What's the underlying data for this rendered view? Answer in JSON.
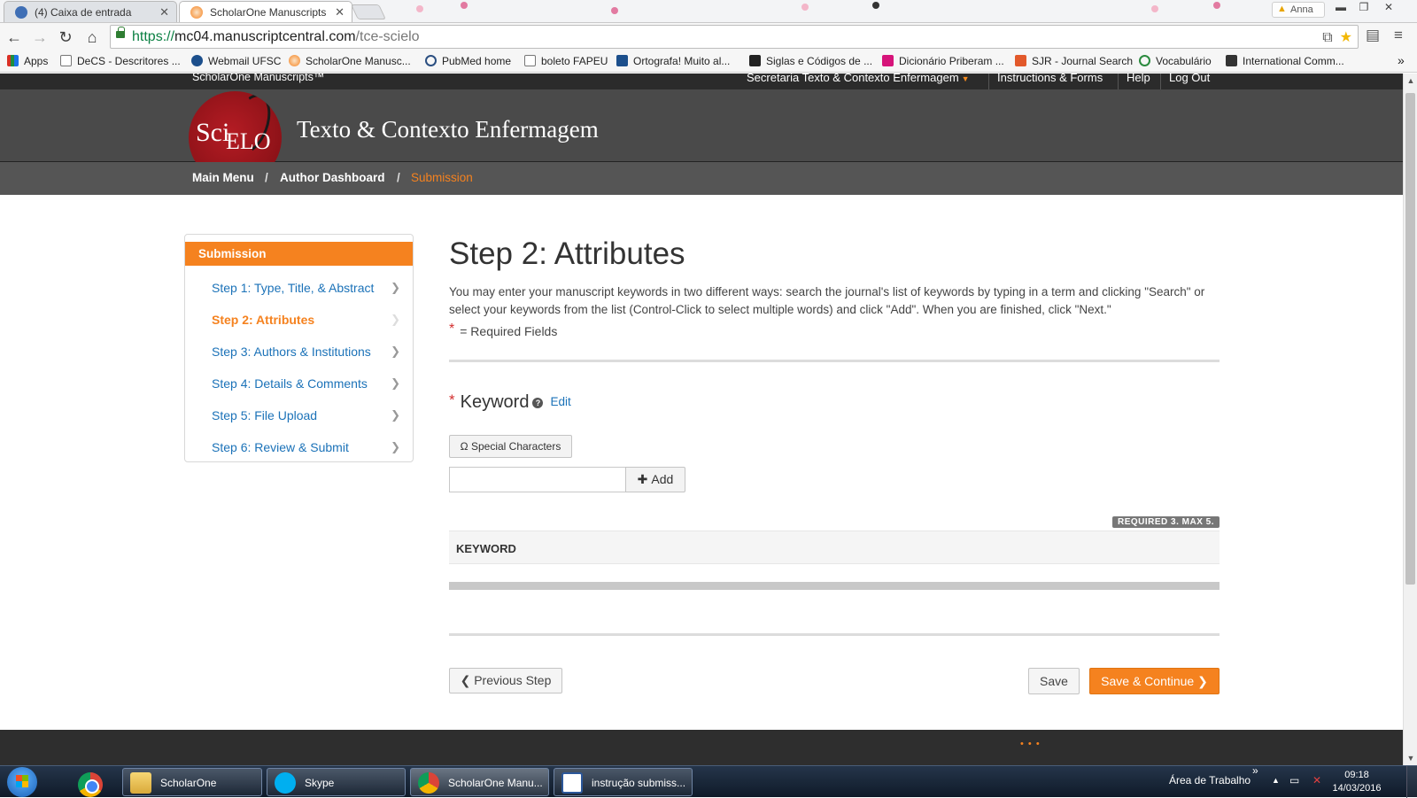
{
  "browser": {
    "tabs": [
      {
        "title": "(4) Caixa de entrada",
        "icon": "envelope-icon",
        "active": false
      },
      {
        "title": "ScholarOne Manuscripts",
        "icon": "scholarone-icon",
        "active": true
      }
    ],
    "user_label": "Anna",
    "url": {
      "scheme": "https://",
      "host": "mc04.manuscriptcentral.com",
      "path": "/tce-scielo"
    },
    "bookmarks": [
      {
        "label": "Apps",
        "icon": "apps-grid-icon"
      },
      {
        "label": "DeCS - Descritores ...",
        "icon": "page-icon"
      },
      {
        "label": "Webmail UFSC",
        "icon": "webmail-icon"
      },
      {
        "label": "ScholarOne Manusc...",
        "icon": "scholarone-icon"
      },
      {
        "label": "PubMed home",
        "icon": "pubmed-icon"
      },
      {
        "label": "boleto FAPEU",
        "icon": "page-icon"
      },
      {
        "label": "Ortografa! Muito al...",
        "icon": "ortografa-icon"
      },
      {
        "label": "Siglas e Códigos de ...",
        "icon": "inf-icon"
      },
      {
        "label": "Dicionário Priberam ...",
        "icon": "priberam-icon"
      },
      {
        "label": "SJR - Journal Search",
        "icon": "sjr-icon"
      },
      {
        "label": "Vocabulário",
        "icon": "vocabulario-icon"
      },
      {
        "label": "International Comm...",
        "icon": "icmje-icon"
      }
    ],
    "bookmarks_overflow": "»"
  },
  "site": {
    "brand": "ScholarOne Manuscripts™",
    "top_nav": [
      "Secretaria Texto & Contexto Enfermagem",
      "Instructions & Forms",
      "Help",
      "Log Out"
    ],
    "logo_text_1": "Sci",
    "logo_text_2": "ELO",
    "journal_title": "Texto & Contexto Enfermagem",
    "breadcrumbs": [
      "Main Menu",
      "Author Dashboard",
      "Submission"
    ],
    "breadcrumb_separator": "/"
  },
  "sidebar": {
    "heading": "Submission",
    "steps": [
      {
        "label": "Step 1: Type, Title, & Abstract",
        "active": false
      },
      {
        "label": "Step 2: Attributes",
        "active": true
      },
      {
        "label": "Step 3: Authors & Institutions",
        "active": false
      },
      {
        "label": "Step 4: Details & Comments",
        "active": false
      },
      {
        "label": "Step 5: File Upload",
        "active": false
      },
      {
        "label": "Step 6: Review & Submit",
        "active": false
      }
    ]
  },
  "main": {
    "title": "Step 2: Attributes",
    "intro": "You may enter your manuscript keywords in two different ways: search the journal's list of keywords by typing in a term and clicking \"Search\" or select your keywords from the list (Control-Click to select multiple words) and click \"Add\". When you are finished, click \"Next.\"",
    "required_marker": "*",
    "required_text": "= Required Fields",
    "keyword_label": "Keyword",
    "help_symbol": "?",
    "edit_label": "Edit",
    "special_chars_label": "Ω Special Characters",
    "keyword_input_value": "",
    "add_label": "Add",
    "badge": "REQUIRED 3. MAX 5.",
    "table_header": "KEYWORD",
    "prev_label": "Previous Step",
    "save_label": "Save",
    "continue_label": "Save & Continue"
  },
  "taskbar": {
    "tasks": [
      {
        "label": "ScholarOne",
        "icon": "folder-icon"
      },
      {
        "label": "Skype",
        "icon": "skype-icon"
      },
      {
        "label": "ScholarOne Manu...",
        "icon": "chrome-icon"
      },
      {
        "label": "instrução submiss...",
        "icon": "word-icon"
      }
    ],
    "desktop_label": "Área de Trabalho",
    "desktop_chevron": "»",
    "time": "09:18",
    "date": "14/03/2016"
  },
  "colors": {
    "accent_orange": "#f5821f",
    "link_blue": "#1b72b8",
    "header_dark": "#4a4a4a",
    "crumb_bar": "#555555"
  }
}
